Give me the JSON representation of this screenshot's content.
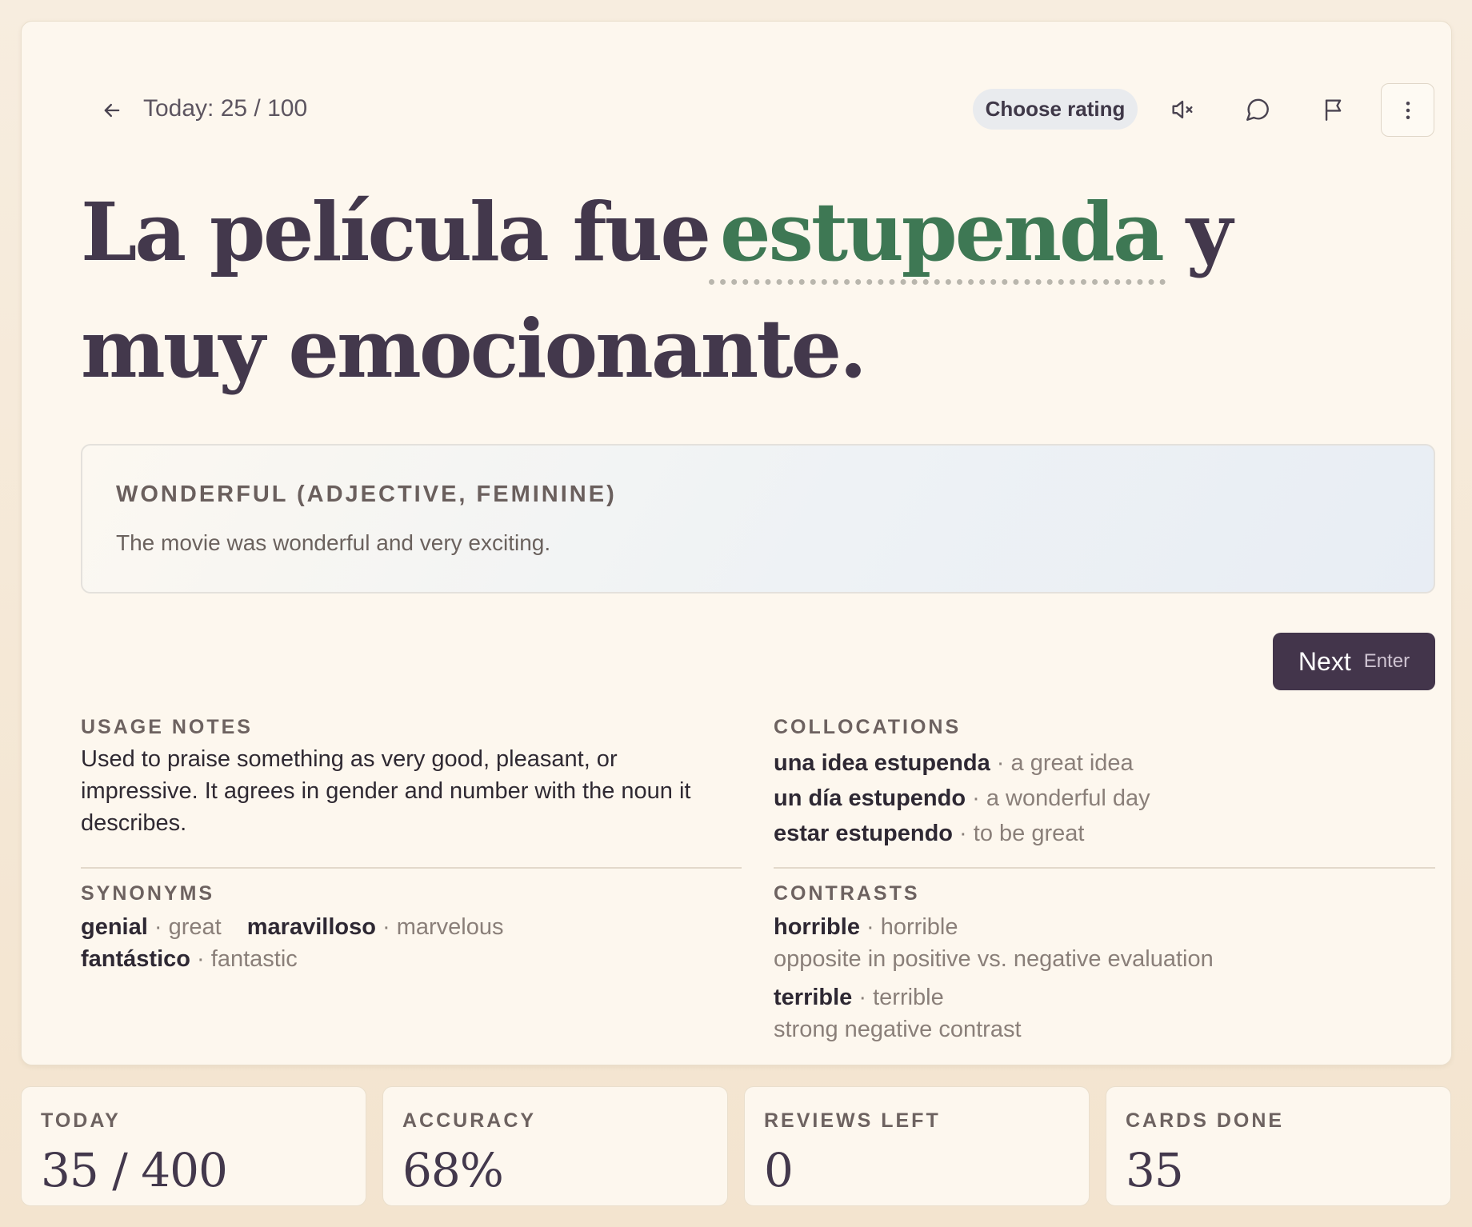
{
  "header": {
    "progress_text": "Today: 25 / 100",
    "rating_button": "Choose rating",
    "icons": [
      "arrow-left-icon",
      "mute-icon",
      "chat-icon",
      "flag-icon",
      "more-vertical-icon"
    ]
  },
  "sentence": {
    "before": "La película fue",
    "target": "estupenda",
    "after": "y muy emocionante."
  },
  "meaning": {
    "title": "WONDERFUL (ADJECTIVE, FEMININE)",
    "translation": "The movie was wonderful and very exciting."
  },
  "next": {
    "label": "Next",
    "hint": "Enter"
  },
  "usage": {
    "label": "USAGE NOTES",
    "text": "Used to praise something as very good, pleasant, or impressive. It agrees in gender and number with the noun it describes."
  },
  "collocations": {
    "label": "COLLOCATIONS",
    "items": [
      {
        "term": "una idea estupenda",
        "gloss": "a great idea"
      },
      {
        "term": "un día estupendo",
        "gloss": "a wonderful day"
      },
      {
        "term": "estar estupendo",
        "gloss": "to be great"
      }
    ]
  },
  "synonyms": {
    "label": "SYNONYMS",
    "items": [
      {
        "term": "genial",
        "gloss": "great"
      },
      {
        "term": "maravilloso",
        "gloss": "marvelous"
      },
      {
        "term": "fantástico",
        "gloss": "fantastic"
      }
    ]
  },
  "contrasts": {
    "label": "CONTRASTS",
    "items": [
      {
        "term": "horrible",
        "gloss": "horrible",
        "note": "opposite in positive vs. negative evaluation"
      },
      {
        "term": "terrible",
        "gloss": "terrible",
        "note": "strong negative contrast"
      }
    ]
  },
  "stats": [
    {
      "label": "TODAY",
      "value": "35 / 400"
    },
    {
      "label": "ACCURACY",
      "value": "68%"
    },
    {
      "label": "REVIEWS LEFT",
      "value": "0"
    },
    {
      "label": "CARDS DONE",
      "value": "35"
    }
  ],
  "colors": {
    "accent_green": "#3e7854",
    "ink": "#43384c",
    "button_dark": "#43354b",
    "card_bg": "#fdf7ee"
  }
}
